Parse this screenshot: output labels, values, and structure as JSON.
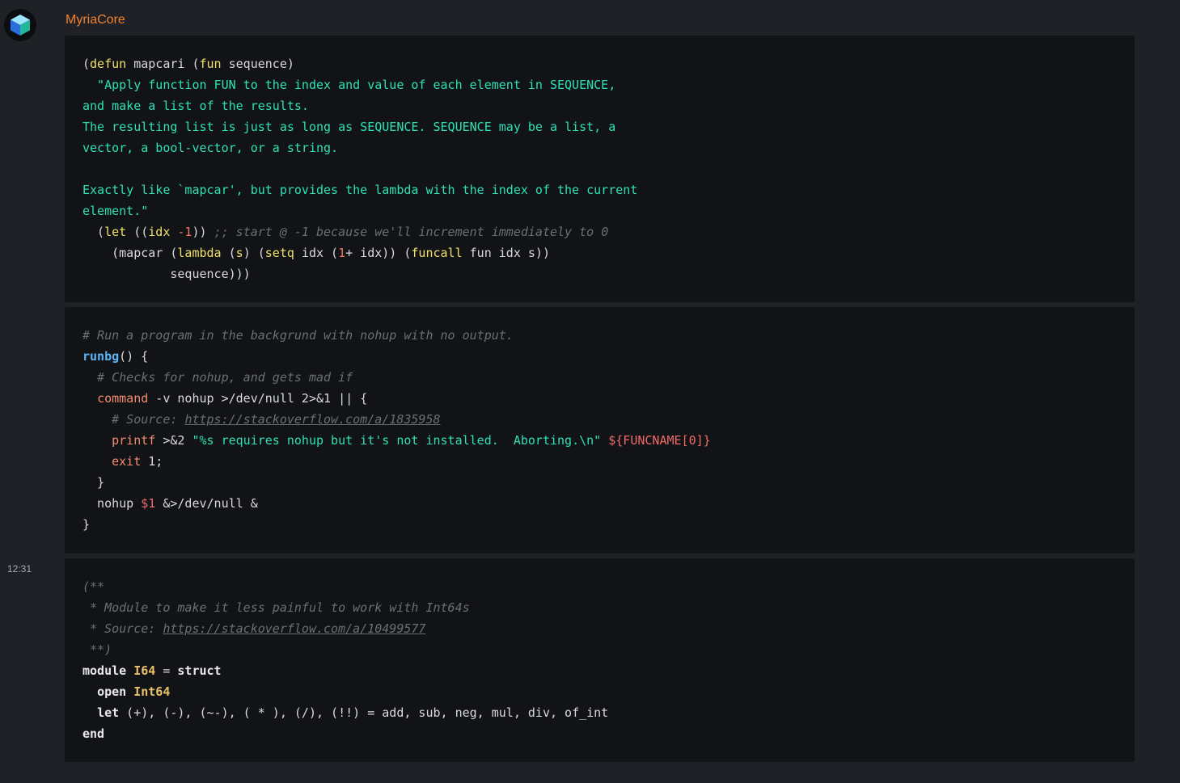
{
  "message": {
    "author": "MyriaCore",
    "time": "12:31",
    "avatar_icon": "cube-icon"
  },
  "colors": {
    "author": "#f0822e",
    "string": "#2ee0b6",
    "keyword": "#f0e06a",
    "comment": "#6c6e76",
    "function_name": "#5fb4f5",
    "bash_command": "#f38c6e"
  },
  "code_blocks": [
    {
      "language": "elisp",
      "lines": [
        [
          {
            "t": "(",
            "c": ""
          },
          {
            "t": "defun",
            "c": "kw"
          },
          {
            "t": " mapcari (",
            "c": ""
          },
          {
            "t": "fun",
            "c": "kw"
          },
          {
            "t": " sequence)",
            "c": ""
          }
        ],
        [
          {
            "t": "  \"Apply function FUN to the index and value of each element in SEQUENCE,",
            "c": "str"
          }
        ],
        [
          {
            "t": "and make a list of the results.",
            "c": "str"
          }
        ],
        [
          {
            "t": "The resulting list is just as long as SEQUENCE. SEQUENCE may be a list, a",
            "c": "str"
          }
        ],
        [
          {
            "t": "vector, a bool-vector, or a string.",
            "c": "str"
          }
        ],
        [
          {
            "t": "",
            "c": ""
          }
        ],
        [
          {
            "t": "Exactly like `mapcar', but provides the lambda with the index of the current",
            "c": "str"
          }
        ],
        [
          {
            "t": "element.\"",
            "c": "str"
          }
        ],
        [
          {
            "t": "  (",
            "c": ""
          },
          {
            "t": "let",
            "c": "kw"
          },
          {
            "t": " ((",
            "c": ""
          },
          {
            "t": "idx",
            "c": "kw"
          },
          {
            "t": " ",
            "c": ""
          },
          {
            "t": "-1",
            "c": "num"
          },
          {
            "t": ")) ",
            "c": ""
          },
          {
            "t": ";; start @ -1 because we'll increment immediately to 0",
            "c": "com"
          }
        ],
        [
          {
            "t": "    (mapcar (",
            "c": ""
          },
          {
            "t": "lambda",
            "c": "kw"
          },
          {
            "t": " (",
            "c": ""
          },
          {
            "t": "s",
            "c": "kw"
          },
          {
            "t": ") (",
            "c": ""
          },
          {
            "t": "setq",
            "c": "kw"
          },
          {
            "t": " idx (",
            "c": ""
          },
          {
            "t": "1",
            "c": "num"
          },
          {
            "t": "+ idx)) (",
            "c": ""
          },
          {
            "t": "funcall",
            "c": "kw"
          },
          {
            "t": " fun idx s))",
            "c": ""
          }
        ],
        [
          {
            "t": "            sequence)))",
            "c": ""
          }
        ]
      ]
    },
    {
      "language": "bash",
      "lines": [
        [
          {
            "t": "# Run a program in the backgrund with nohup with no output.",
            "c": "com"
          }
        ],
        [
          {
            "t": "runbg",
            "c": "fn"
          },
          {
            "t": "() {",
            "c": ""
          }
        ],
        [
          {
            "t": "  # Checks for nohup, and gets mad if",
            "c": "com"
          }
        ],
        [
          {
            "t": "  ",
            "c": ""
          },
          {
            "t": "command",
            "c": "cmd"
          },
          {
            "t": " -v nohup >/dev/null 2>&1 || {",
            "c": ""
          }
        ],
        [
          {
            "t": "    # Source: ",
            "c": "com"
          },
          {
            "t": "https://stackoverflow.com/a/1835958",
            "c": "link"
          }
        ],
        [
          {
            "t": "    ",
            "c": ""
          },
          {
            "t": "printf",
            "c": "cmd"
          },
          {
            "t": " >&2 ",
            "c": ""
          },
          {
            "t": "\"%s requires nohup but it's not installed.  Aborting.\\n\"",
            "c": "str"
          },
          {
            "t": " ",
            "c": ""
          },
          {
            "t": "${FUNCNAME[0]}",
            "c": "var"
          }
        ],
        [
          {
            "t": "    ",
            "c": ""
          },
          {
            "t": "exit",
            "c": "cmd"
          },
          {
            "t": " 1;",
            "c": ""
          }
        ],
        [
          {
            "t": "  }",
            "c": ""
          }
        ],
        [
          {
            "t": "  nohup ",
            "c": ""
          },
          {
            "t": "$1",
            "c": "var"
          },
          {
            "t": " &>/dev/null &",
            "c": ""
          }
        ],
        [
          {
            "t": "}",
            "c": ""
          }
        ]
      ]
    },
    {
      "language": "ocaml",
      "lines": [
        [
          {
            "t": "(**",
            "c": "com"
          }
        ],
        [
          {
            "t": " * Module to make it less painful to work with Int64s",
            "c": "com"
          }
        ],
        [
          {
            "t": " * Source: ",
            "c": "com"
          },
          {
            "t": "https://stackoverflow.com/a/10499577",
            "c": "link"
          }
        ],
        [
          {
            "t": " **)",
            "c": "com"
          }
        ],
        [
          {
            "t": "module",
            "c": "okw"
          },
          {
            "t": " ",
            "c": ""
          },
          {
            "t": "I64",
            "c": "mod"
          },
          {
            "t": " = ",
            "c": ""
          },
          {
            "t": "struct",
            "c": "okw"
          }
        ],
        [
          {
            "t": "  ",
            "c": ""
          },
          {
            "t": "open",
            "c": "okw"
          },
          {
            "t": " ",
            "c": ""
          },
          {
            "t": "Int64",
            "c": "mod"
          }
        ],
        [
          {
            "t": "  ",
            "c": ""
          },
          {
            "t": "let",
            "c": "okw"
          },
          {
            "t": " (+), (-), (~-), ( * ), (/), (!!) = add, sub, neg, mul, div, of_int",
            "c": ""
          }
        ],
        [
          {
            "t": "end",
            "c": "okw"
          }
        ]
      ]
    }
  ]
}
